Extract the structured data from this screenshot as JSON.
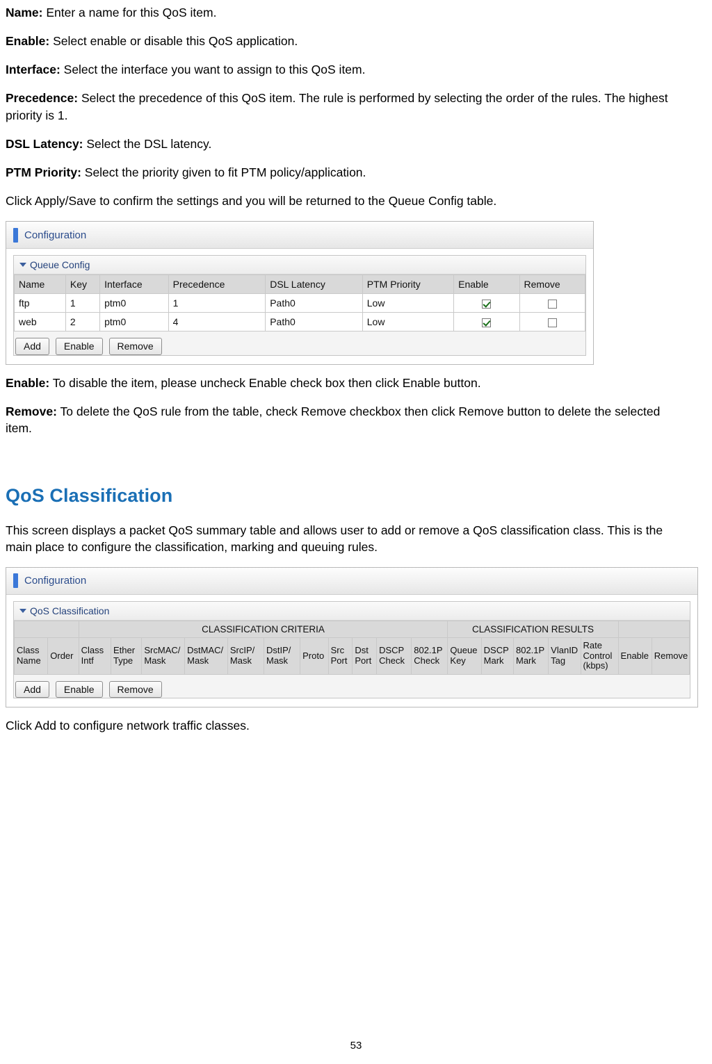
{
  "document": {
    "page_number": "53",
    "paragraphs": [
      {
        "label": "Name:",
        "text": " Enter a name for this QoS item."
      },
      {
        "label": "Enable:",
        "text": " Select enable or disable this QoS application."
      },
      {
        "label": "Interface:",
        "text": " Select the interface you want to assign to this QoS item."
      },
      {
        "label": "Precedence:",
        "text": " Select the precedence of this QoS item. The rule is performed by selecting the order of the rules. The highest priority is 1."
      },
      {
        "label": "DSL Latency:",
        "text": " Select the DSL latency."
      },
      {
        "label": "PTM Priority:",
        "text": " Select the priority given to fit PTM policy/application."
      },
      {
        "label": "",
        "text": "Click Apply/Save to confirm the settings and you will be returned to the Queue Config table."
      }
    ],
    "after_paragraphs": [
      {
        "label": "Enable:",
        "text": " To disable the item, please uncheck Enable check box then click Enable button."
      },
      {
        "label": "Remove:",
        "text": " To delete the QoS rule from the table, check Remove checkbox then click Remove button to delete the selected item."
      }
    ],
    "section_title": "QoS Classification",
    "section_intro": "This screen displays a packet QoS summary table and allows user to add or remove a QoS classification class. This is the main place to configure the classification, marking and queuing rules.",
    "closing_text": "Click Add to configure network traffic classes."
  },
  "queue_config_shot": {
    "header_title": "Configuration",
    "panel_title": "Queue Config",
    "columns": [
      "Name",
      "Key",
      "Interface",
      "Precedence",
      "DSL Latency",
      "PTM Priority",
      "Enable",
      "Remove"
    ],
    "rows": [
      {
        "name": "ftp",
        "key": "1",
        "interface": "ptm0",
        "precedence": "1",
        "dsl_latency": "Path0",
        "ptm_priority": "Low",
        "enable": true,
        "remove": false
      },
      {
        "name": "web",
        "key": "2",
        "interface": "ptm0",
        "precedence": "4",
        "dsl_latency": "Path0",
        "ptm_priority": "Low",
        "enable": true,
        "remove": false
      }
    ],
    "buttons": [
      "Add",
      "Enable",
      "Remove"
    ]
  },
  "qos_classification_shot": {
    "header_title": "Configuration",
    "panel_title": "QoS Classification",
    "group_criteria": "CLASSIFICATION CRITERIA",
    "group_results": "CLASSIFICATION RESULTS",
    "columns": [
      "Class Name",
      "Order",
      "Class Intf",
      "Ether Type",
      "SrcMAC/ Mask",
      "DstMAC/ Mask",
      "SrcIP/ Mask",
      "DstIP/ Mask",
      "Proto",
      "Src Port",
      "Dst Port",
      "DSCP Check",
      "802.1P Check",
      "Queue Key",
      "DSCP Mark",
      "802.1P Mark",
      "VlanID Tag",
      "Rate Control (kbps)",
      "Enable",
      "Remove"
    ],
    "buttons": [
      "Add",
      "Enable",
      "Remove"
    ]
  },
  "colors": {
    "accent_blue": "#3b78d8",
    "heading_blue": "#1a6fb5",
    "panel_title_blue": "#25437c",
    "table_header_gray": "#d9d9d9"
  }
}
